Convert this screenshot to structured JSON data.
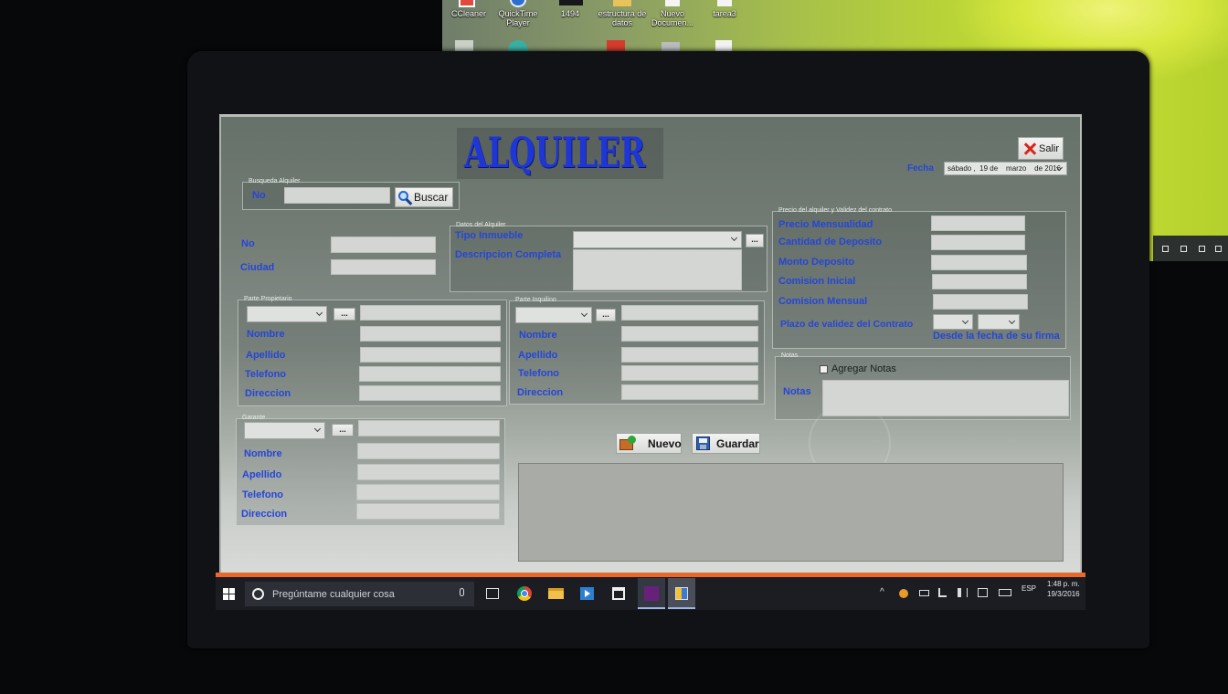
{
  "colors": {
    "label_blue": "#2446d8",
    "title_blue": "#1f36d6",
    "form_bg_top": "#66716a",
    "form_bg_bottom": "#d8dbd7",
    "taskbar": "#1b1d22",
    "accent_orange": "#e8692b",
    "wallpaper_green": "#b9d437"
  },
  "second_monitor": {
    "desktop_icons": [
      {
        "label": "CCleaner",
        "icon": "ccleaner-icon"
      },
      {
        "label": "QuickTime Player",
        "icon": "quicktime-icon"
      },
      {
        "label": "1494",
        "icon": "file-icon"
      },
      {
        "label": "estructura de datos",
        "icon": "folder-icon"
      },
      {
        "label": "Nuevo Documen...",
        "icon": "document-icon"
      },
      {
        "label": "tarea3",
        "icon": "document-icon"
      }
    ]
  },
  "header": {
    "title": "ALQUILER",
    "exit_button": "Salir",
    "exit_icon": "close-icon",
    "date_label": "Fecha",
    "date_value": "sábado ,  19 de    marzo    de 2016"
  },
  "search": {
    "legend": "Busqueda Alquiler",
    "label": "No",
    "value": "",
    "button": "Buscar",
    "button_icon": "search-icon"
  },
  "location": {
    "number_label": "No",
    "number_value": "",
    "city_label": "Ciudad",
    "city_value": ""
  },
  "rental_data": {
    "legend": "Datos del Alquiler",
    "type_label": "Tipo Inmueble",
    "type_value": "",
    "description_label": "Descripcion Completa",
    "description_value": "",
    "browse_button": "..."
  },
  "price": {
    "legend": "Precio del alquiler y Validez del contrato",
    "fields": [
      {
        "label": "Precio Mensualidad",
        "value": ""
      },
      {
        "label": "Cantidad de Deposito",
        "value": ""
      },
      {
        "label": "Monto Deposito",
        "value": ""
      },
      {
        "label": "Comision Inicial",
        "value": ""
      },
      {
        "label": "Comision Mensual",
        "value": ""
      }
    ],
    "term_label": "Plazo de validez del Contrato",
    "term_note": "Desde la fecha de su firma"
  },
  "notes": {
    "legend": "Notas",
    "checkbox_label": "Agregar Notas",
    "checked": false,
    "label": "Notas",
    "value": ""
  },
  "owner": {
    "legend": "Parte Propietario",
    "browse_button": "...",
    "search_value": "",
    "fields": [
      {
        "label": "Nombre",
        "value": ""
      },
      {
        "label": "Apellido",
        "value": ""
      },
      {
        "label": "Telefono",
        "value": ""
      },
      {
        "label": "Direccion",
        "value": ""
      }
    ]
  },
  "tenant": {
    "legend": "Parte Inquilino",
    "browse_button": "...",
    "search_value": "",
    "fields": [
      {
        "label": "Nombre",
        "value": ""
      },
      {
        "label": "Apellido",
        "value": ""
      },
      {
        "label": "Telefono",
        "value": ""
      },
      {
        "label": "Direccion",
        "value": ""
      }
    ]
  },
  "guarantor": {
    "legend": "Garante",
    "browse_button": "...",
    "search_value": "",
    "fields": [
      {
        "label": "Nombre",
        "value": ""
      },
      {
        "label": "Apellido",
        "value": ""
      },
      {
        "label": "Telefono",
        "value": ""
      },
      {
        "label": "Direccion",
        "value": ""
      }
    ]
  },
  "actions": {
    "new_button": "Nuevo",
    "new_icon": "new-folder-icon",
    "save_button": "Guardar",
    "save_icon": "floppy-disk-icon"
  },
  "grid": {
    "rows": []
  },
  "taskbar": {
    "search_placeholder": "Pregúntame cualquier cosa",
    "apps": [
      "task-view-icon",
      "chrome-icon",
      "file-explorer-icon",
      "media-player-icon",
      "store-icon",
      "visual-studio-icon",
      "rental-app-icon"
    ],
    "language": "ESP",
    "time": "1:48 p. m.",
    "date": "19/3/2016"
  }
}
